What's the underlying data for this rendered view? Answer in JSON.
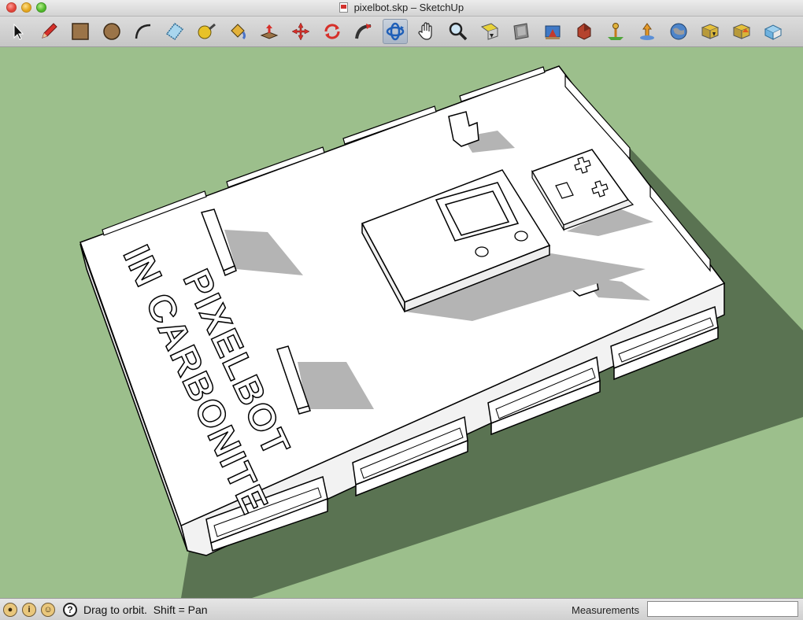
{
  "window": {
    "title": "pixelbot.skp – SketchUp"
  },
  "toolbar": {
    "tools": [
      {
        "name": "select-tool",
        "icon": "arrow-cursor-icon"
      },
      {
        "name": "line-tool",
        "icon": "pencil-icon"
      },
      {
        "name": "rectangle-tool",
        "icon": "rectangle-icon"
      },
      {
        "name": "circle-tool",
        "icon": "circle-icon"
      },
      {
        "name": "arc-tool",
        "icon": "arc-icon"
      },
      {
        "name": "make-component-tool",
        "icon": "component-icon"
      },
      {
        "name": "tape-measure-tool",
        "icon": "tape-measure-icon"
      },
      {
        "name": "paint-bucket-tool",
        "icon": "paint-bucket-icon"
      },
      {
        "name": "push-pull-tool",
        "icon": "push-pull-icon"
      },
      {
        "name": "move-tool",
        "icon": "move-icon"
      },
      {
        "name": "rotate-tool",
        "icon": "rotate-icon"
      },
      {
        "name": "follow-me-tool",
        "icon": "follow-me-icon"
      },
      {
        "name": "orbit-tool",
        "icon": "orbit-icon",
        "active": true
      },
      {
        "name": "pan-tool",
        "icon": "hand-icon"
      },
      {
        "name": "zoom-tool",
        "icon": "magnifier-icon"
      },
      {
        "name": "zoom-extents-tool",
        "icon": "zoom-extents-icon"
      },
      {
        "name": "previous-view-tool",
        "icon": "previous-view-icon"
      },
      {
        "name": "get-models-tool",
        "icon": "get-models-icon"
      },
      {
        "name": "share-model-tool",
        "icon": "share-model-icon"
      },
      {
        "name": "add-location-tool",
        "icon": "add-location-icon"
      },
      {
        "name": "toggle-terrain-tool",
        "icon": "toggle-terrain-icon"
      },
      {
        "name": "photo-textures-tool",
        "icon": "globe-icon"
      },
      {
        "name": "get-component-tool",
        "icon": "get-component-icon"
      },
      {
        "name": "share-component-tool",
        "icon": "share-component-icon"
      },
      {
        "name": "extension-warehouse-tool",
        "icon": "extension-icon"
      }
    ]
  },
  "scene": {
    "background_color": "#9cbf8c",
    "model_color": "#ffffff",
    "shadow_color": "#5a7352",
    "text_line_1": "PIXELBOT",
    "text_line_2": "IN CARBONITE"
  },
  "status": {
    "message": "Drag to orbit.  Shift = Pan",
    "icons": [
      "geo-location-icon",
      "credits-icon",
      "user-icon"
    ],
    "help_icon": "?",
    "measurements_label": "Measurements",
    "measurements_value": ""
  }
}
